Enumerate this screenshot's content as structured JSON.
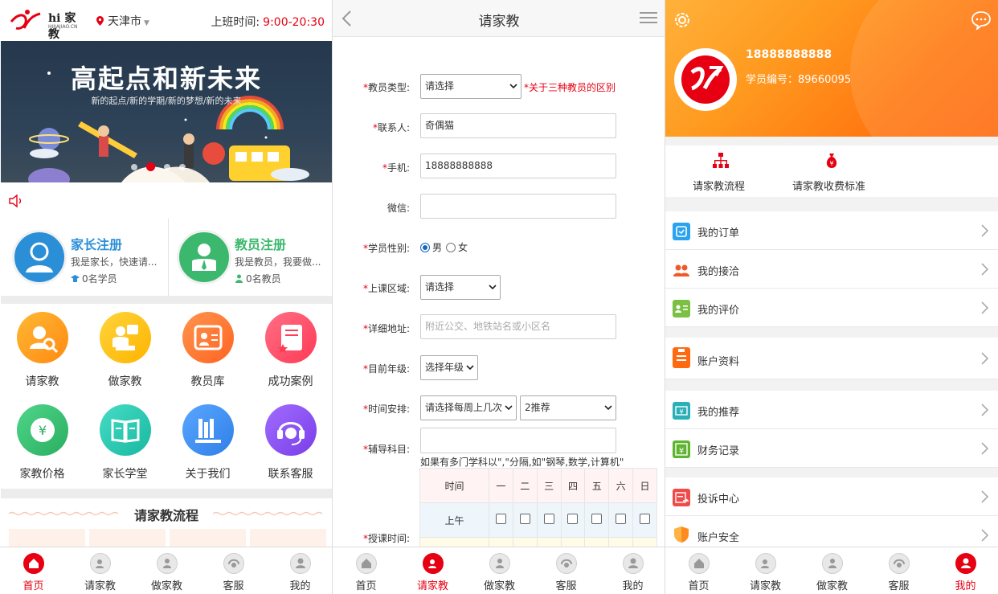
{
  "home": {
    "logo_text": "hi 家教",
    "logo_sub": "HIJIAJIAO.CN",
    "city": "天津市",
    "work_label": "上班时间:",
    "work_hours": "9:00-20:30",
    "banner_title": "高起点和新未来",
    "banner_sub": "新的起点/新的学期/新的梦想/新的未来",
    "parent_reg": {
      "title": "家长注册",
      "desc": "我是家长，快速请...",
      "count": "0名学员",
      "color": "#2b8fd8"
    },
    "teacher_reg": {
      "title": "教员注册",
      "desc": "我是教员，我要做...",
      "count": "0名教员",
      "color": "#3cb86e"
    },
    "grid": [
      {
        "label": "请家教",
        "icon": "search-person-icon",
        "color": "#ff9f1c"
      },
      {
        "label": "做家教",
        "icon": "teacher-board-icon",
        "color": "#ffc21f"
      },
      {
        "label": "教员库",
        "icon": "teacher-card-icon",
        "color": "#ff7a3a"
      },
      {
        "label": "成功案例",
        "icon": "certificate-icon",
        "color": "#ff4f6d"
      },
      {
        "label": "家教价格",
        "icon": "yuan-icon",
        "color": "#3cc174"
      },
      {
        "label": "家长学堂",
        "icon": "book-icon",
        "color": "#2ec8b4"
      },
      {
        "label": "关于我们",
        "icon": "books-icon",
        "color": "#3d8ef0"
      },
      {
        "label": "联系客服",
        "icon": "headset-icon",
        "color": "#8a4ff0"
      }
    ],
    "flow_title": "请家教流程"
  },
  "form": {
    "title": "请家教",
    "fields": {
      "type": {
        "label": "教员类型:",
        "value": "请选择",
        "note": "*关于三种教员的区别"
      },
      "contact": {
        "label": "联系人:",
        "value": "奇偶猫"
      },
      "phone": {
        "label": "手机:",
        "value": "18888888888"
      },
      "wechat": {
        "label": "微信:",
        "value": ""
      },
      "gender": {
        "label": "学员性别:",
        "male": "男",
        "female": "女"
      },
      "area": {
        "label": "上课区域:",
        "value": "请选择"
      },
      "address": {
        "label": "详细地址:",
        "placeholder": "附近公交、地铁站名或小区名"
      },
      "grade": {
        "label": "目前年级:",
        "value": "选择年级"
      },
      "times": {
        "label": "时间安排:",
        "value": "请选择每周上几次",
        "value2": "2推荐"
      },
      "subject": {
        "label": "辅导科目:",
        "value": "",
        "hint": "如果有多门学科以\",\"分隔,如\"钢琴,数学,计算机\""
      },
      "schedule": {
        "label": "授课时间:"
      }
    },
    "schedule": {
      "header": "时间",
      "days": [
        "一",
        "二",
        "三",
        "四",
        "五",
        "六",
        "日"
      ],
      "am": "上午"
    }
  },
  "profile": {
    "phone": "18888888888",
    "student_id": "学员编号：89660095",
    "quick": [
      {
        "label": "请家教流程",
        "icon": "flowchart-icon"
      },
      {
        "label": "请家教收费标准",
        "icon": "money-bag-icon"
      }
    ],
    "menu": [
      {
        "label": "我的订单",
        "icon": "order-icon",
        "color": "#2aa3ef"
      },
      {
        "label": "我的接洽",
        "icon": "contacts-icon",
        "color": "#f05a28"
      },
      {
        "label": "我的评价",
        "icon": "review-icon",
        "color": "#7ac143"
      },
      {
        "label": "账户资料",
        "icon": "clipboard-icon",
        "color": "#ff6a10"
      },
      {
        "label": "我的推荐",
        "icon": "ticket-icon",
        "color": "#2bb0b8"
      },
      {
        "label": "财务记录",
        "icon": "finance-icon",
        "color": "#5fb531"
      },
      {
        "label": "投诉中心",
        "icon": "complaint-icon",
        "color": "#ef4b4b"
      },
      {
        "label": "账户安全",
        "icon": "shield-icon",
        "color": "#ff8a1f"
      }
    ]
  },
  "tabs": [
    "首页",
    "请家教",
    "做家教",
    "客服",
    "我的"
  ],
  "colors": {
    "accent": "#e60012",
    "orange": "#ff8a1f"
  }
}
